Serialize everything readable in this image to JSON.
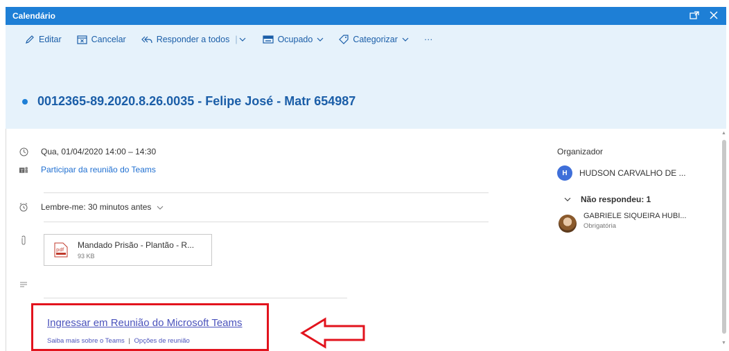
{
  "window": {
    "title": "Calendário",
    "popout_icon": "popout-icon",
    "close_icon": "close-icon"
  },
  "toolbar": {
    "edit_label": "Editar",
    "cancel_label": "Cancelar",
    "reply_all_label": "Responder a todos",
    "busy_label": "Ocupado",
    "categorize_label": "Categorizar",
    "more_label": "···"
  },
  "event": {
    "title": "0012365-89.2020.8.26.0035 - Felipe José - Matr 654987",
    "datetime": "Qua, 01/04/2020 14:00 – 14:30",
    "teams_join_link": "Participar da reunião do Teams",
    "reminder": "Lembre-me: 30 minutos antes"
  },
  "attachment": {
    "name": "Mandado Prisão - Plantão - R...",
    "size": "93 KB",
    "icon_label": "pdf"
  },
  "teams": {
    "join_label": "Ingressar em Reunião do Microsoft Teams",
    "learn_more": "Saiba mais sobre o Teams",
    "separator": "|",
    "meeting_options": "Opções de reunião"
  },
  "attendees": {
    "organizer_label": "Organizador",
    "organizer_initial": "H",
    "organizer_name": "HUDSON CARVALHO DE ...",
    "not_responded_label": "Não respondeu: 1",
    "attendee_name": "GABRIELE SIQUEIRA HUBI...",
    "attendee_role": "Obrigatória"
  },
  "colors": {
    "title_bar": "#1e7fd6",
    "header_bg": "#e6f2fb",
    "accent_text": "#1b5ea8",
    "teams_link": "#4b53bc",
    "highlight_red": "#e2131d"
  }
}
